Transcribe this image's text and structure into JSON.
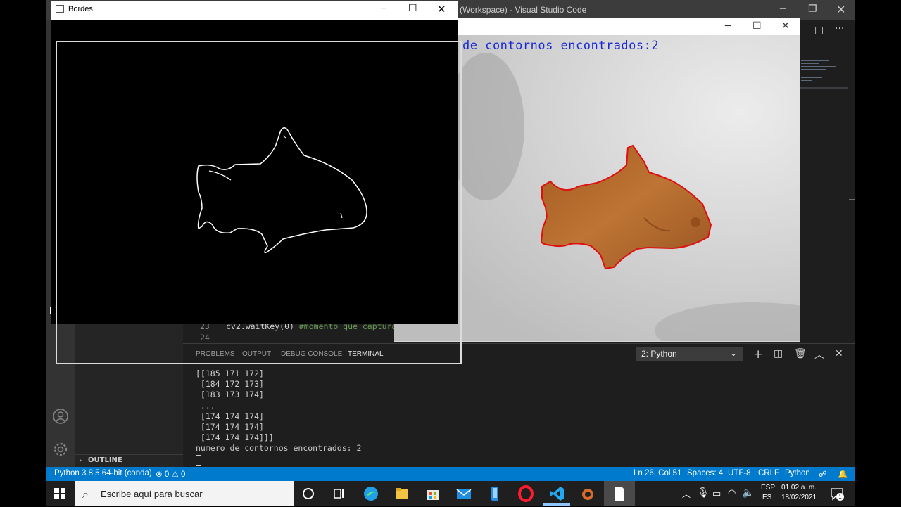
{
  "vscode": {
    "title": "(Workspace) - Visual Studio Code",
    "code_lines": [
      {
        "num": "23",
        "code": "cv2.waitKey(0)",
        "comment": "#momento que captura"
      },
      {
        "num": "24",
        "code": "",
        "comment": ""
      }
    ],
    "sidebar": {
      "outline_label": "OUTLINE"
    },
    "panel": {
      "tabs": [
        "PROBLEMS",
        "OUTPUT",
        "DEBUG CONSOLE",
        "TERMINAL"
      ],
      "active_tab": "TERMINAL",
      "terminal_selector": "2: Python",
      "terminal_lines": [
        "[[185 171 172]",
        " [184 172 173]",
        " [183 173 174]",
        " ...",
        " [174 174 174]",
        " [174 174 174]",
        " [174 174 174]]]",
        "numero de contornos encontrados: 2"
      ]
    },
    "statusbar": {
      "interpreter": "Python 3.8.5 64-bit (conda)",
      "errors": "0",
      "warnings": "0",
      "position": "Ln 26, Col 51",
      "spaces": "Spaces: 4",
      "encoding": "UTF-8",
      "eol": "CRLF",
      "language": "Python"
    }
  },
  "camera_window": {
    "overlay_text": "de contornos encontrados:2"
  },
  "bordes_window": {
    "title": "Bordes"
  },
  "taskbar": {
    "search_placeholder": "Escribe aquí para buscar",
    "language": "ESP",
    "layout": "ES",
    "time": "01:02 a. m.",
    "date": "18/02/2021",
    "notification_count": "1"
  },
  "icons": {
    "start": "windows-logo-icon",
    "search": "search-icon",
    "task_view": "task-view-icon",
    "edge": "edge-icon",
    "explorer": "file-explorer-icon",
    "store": "store-icon",
    "mail": "mail-icon",
    "phone": "phone-icon",
    "opera": "opera-icon",
    "vscode": "vscode-icon",
    "anaconda": "anaconda-icon",
    "file": "file-icon"
  },
  "colors": {
    "statusbar": "#007acc",
    "contour": "#e01010",
    "overlay_text": "#1a2bd6",
    "fish": "#b56a2a"
  }
}
